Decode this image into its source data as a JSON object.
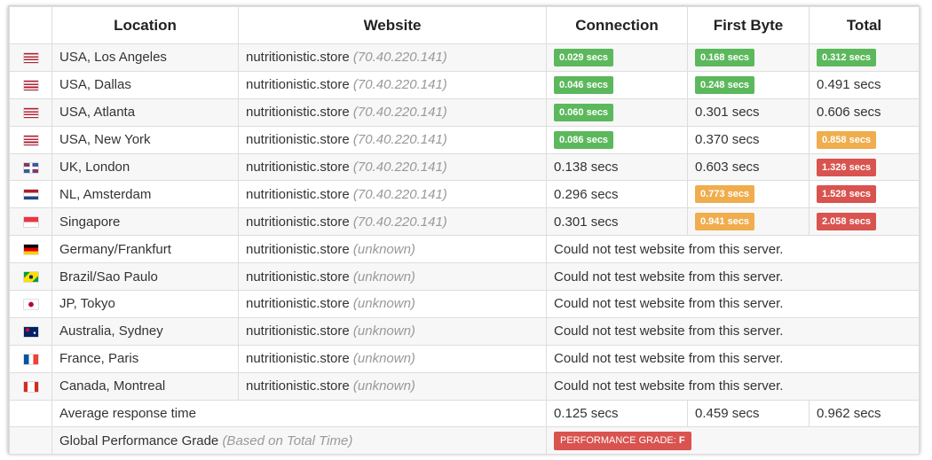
{
  "headers": {
    "location": "Location",
    "website": "Website",
    "connection": "Connection",
    "first_byte": "First Byte",
    "total": "Total"
  },
  "colors": {
    "green": "#5cb85c",
    "orange": "#f0ad4e",
    "red": "#d9534f"
  },
  "rows": [
    {
      "flag": "us-flag-icon",
      "location": "USA, Los Angeles",
      "site": "nutritionistic.store",
      "ip": "(70.40.220.141)",
      "connection": {
        "text": "0.029 secs",
        "badge": "green"
      },
      "first_byte": {
        "text": "0.168 secs",
        "badge": "green"
      },
      "total": {
        "text": "0.312 secs",
        "badge": "green"
      }
    },
    {
      "flag": "us-flag-icon",
      "location": "USA, Dallas",
      "site": "nutritionistic.store",
      "ip": "(70.40.220.141)",
      "connection": {
        "text": "0.046 secs",
        "badge": "green"
      },
      "first_byte": {
        "text": "0.248 secs",
        "badge": "green"
      },
      "total": {
        "text": "0.491 secs",
        "badge": ""
      }
    },
    {
      "flag": "us-flag-icon",
      "location": "USA, Atlanta",
      "site": "nutritionistic.store",
      "ip": "(70.40.220.141)",
      "connection": {
        "text": "0.060 secs",
        "badge": "green"
      },
      "first_byte": {
        "text": "0.301 secs",
        "badge": ""
      },
      "total": {
        "text": "0.606 secs",
        "badge": ""
      }
    },
    {
      "flag": "us-flag-icon",
      "location": "USA, New York",
      "site": "nutritionistic.store",
      "ip": "(70.40.220.141)",
      "connection": {
        "text": "0.086 secs",
        "badge": "green"
      },
      "first_byte": {
        "text": "0.370 secs",
        "badge": ""
      },
      "total": {
        "text": "0.858 secs",
        "badge": "orange"
      }
    },
    {
      "flag": "uk-flag-icon",
      "location": "UK, London",
      "site": "nutritionistic.store",
      "ip": "(70.40.220.141)",
      "connection": {
        "text": "0.138 secs",
        "badge": ""
      },
      "first_byte": {
        "text": "0.603 secs",
        "badge": ""
      },
      "total": {
        "text": "1.326 secs",
        "badge": "red"
      }
    },
    {
      "flag": "nl-flag-icon",
      "location": "NL, Amsterdam",
      "site": "nutritionistic.store",
      "ip": "(70.40.220.141)",
      "connection": {
        "text": "0.296 secs",
        "badge": ""
      },
      "first_byte": {
        "text": "0.773 secs",
        "badge": "orange"
      },
      "total": {
        "text": "1.528 secs",
        "badge": "red"
      }
    },
    {
      "flag": "sg-flag-icon",
      "location": "Singapore",
      "site": "nutritionistic.store",
      "ip": "(70.40.220.141)",
      "connection": {
        "text": "0.301 secs",
        "badge": ""
      },
      "first_byte": {
        "text": "0.941 secs",
        "badge": "orange"
      },
      "total": {
        "text": "2.058 secs",
        "badge": "red"
      }
    },
    {
      "flag": "de-flag-icon",
      "location": "Germany/Frankfurt",
      "site": "nutritionistic.store",
      "ip": "(unknown)",
      "message": "Could not test website from this server."
    },
    {
      "flag": "br-flag-icon",
      "location": "Brazil/Sao Paulo",
      "site": "nutritionistic.store",
      "ip": "(unknown)",
      "message": "Could not test website from this server."
    },
    {
      "flag": "jp-flag-icon",
      "location": "JP, Tokyo",
      "site": "nutritionistic.store",
      "ip": "(unknown)",
      "message": "Could not test website from this server."
    },
    {
      "flag": "au-flag-icon",
      "location": "Australia, Sydney",
      "site": "nutritionistic.store",
      "ip": "(unknown)",
      "message": "Could not test website from this server."
    },
    {
      "flag": "fr-flag-icon",
      "location": "France, Paris",
      "site": "nutritionistic.store",
      "ip": "(unknown)",
      "message": "Could not test website from this server."
    },
    {
      "flag": "ca-flag-icon",
      "location": "Canada, Montreal",
      "site": "nutritionistic.store",
      "ip": "(unknown)",
      "message": "Could not test website from this server."
    }
  ],
  "average": {
    "label": "Average response time",
    "connection": "0.125 secs",
    "first_byte": "0.459 secs",
    "total": "0.962 secs"
  },
  "grade": {
    "label": "Global Performance Grade",
    "note": "(Based on Total Time)",
    "badge_label": "PERFORMANCE GRADE:",
    "badge_value": "F"
  }
}
